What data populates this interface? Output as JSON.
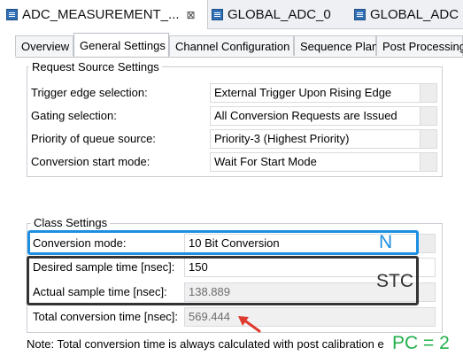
{
  "editor_tabs": [
    {
      "label": "ADC_MEASUREMENT_...",
      "close": "⊠"
    },
    {
      "label": "GLOBAL_ADC_0"
    },
    {
      "label": "GLOBAL_ADC"
    }
  ],
  "page_tabs": [
    "Overview",
    "General Settings",
    "Channel Configuration",
    "Sequence Plan",
    "Post Processing"
  ],
  "request_source": {
    "title": "Request Source Settings",
    "trigger_edge": {
      "label": "Trigger edge selection:",
      "value": "External Trigger Upon Rising Edge"
    },
    "gating": {
      "label": "Gating selection:",
      "value": "All Conversion Requests are Issued"
    },
    "priority": {
      "label": "Priority of queue source:",
      "value": "Priority-3 (Highest Priority)"
    },
    "start_mode": {
      "label": "Conversion start mode:",
      "value": "Wait For Start Mode"
    }
  },
  "class_settings": {
    "title": "Class Settings",
    "conversion_mode": {
      "label": "Conversion mode:",
      "value": "10 Bit Conversion"
    },
    "desired_sample": {
      "label": "Desired sample time [nsec]:",
      "value": "150"
    },
    "actual_sample": {
      "label": "Actual sample time [nsec]:",
      "value": "138.889"
    },
    "total_conversion": {
      "label": "Total conversion time [nsec]:",
      "value": "569.444"
    }
  },
  "note": "Note: Total conversion time is always calculated with post calibration e",
  "annotations": {
    "n_label": "N",
    "stc_label": "STC",
    "pc_label": "PC = 2",
    "blue_color": "#1e8fe0",
    "dark_color": "#333333",
    "green_color": "#22b14c",
    "red_color": "#e03a2e"
  }
}
